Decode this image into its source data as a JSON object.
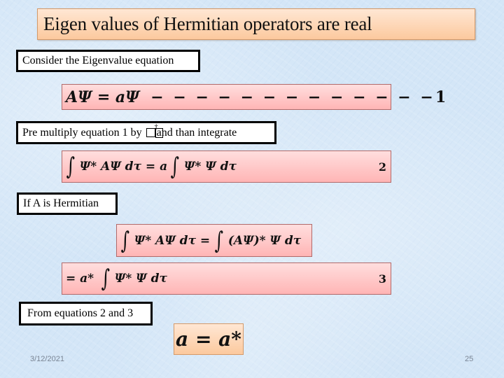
{
  "slide": {
    "title": "Eigen values of Hermitian operators are real",
    "labels": {
      "consider": "Consider the Eigenvalue equation",
      "premultiply_before": "Pre multiply equation 1 by ",
      "premultiply_glyph_dagger": "†",
      "premultiply_after": "and than integrate",
      "if_hermitian": "If A is Hermitian",
      "from_equations": "From equations 2 and 3"
    },
    "equations": {
      "eq1": {
        "lhs": "AΨ = aΨ",
        "dashes": "− − − − − − − − − − − − −",
        "number": "1"
      },
      "eq2": {
        "integral1": "∫",
        "part1": "Ψ* AΨ dτ = a",
        "integral2": "∫",
        "part2": "Ψ* Ψ dτ",
        "number": "2"
      },
      "eq3a": {
        "integral1": "∫",
        "part1": "Ψ* AΨ dτ = ",
        "integral2": "∫",
        "part2": "(AΨ)* Ψ dτ"
      },
      "eq3b": {
        "part1": "= a*",
        "integral1": "∫",
        "part2": "Ψ* Ψ dτ",
        "number": "3"
      },
      "result": "a = a*"
    },
    "footer": {
      "date": "3/12/2021",
      "page_number": "25"
    }
  },
  "colors": {
    "title_box_top": "#ffe7d4",
    "title_box_bottom": "#fcc99e",
    "equation_box_top": "#ffdede",
    "equation_box_bottom": "#ffb5b5",
    "background": "#d4e6f7",
    "footer_text": "#7a8594"
  }
}
